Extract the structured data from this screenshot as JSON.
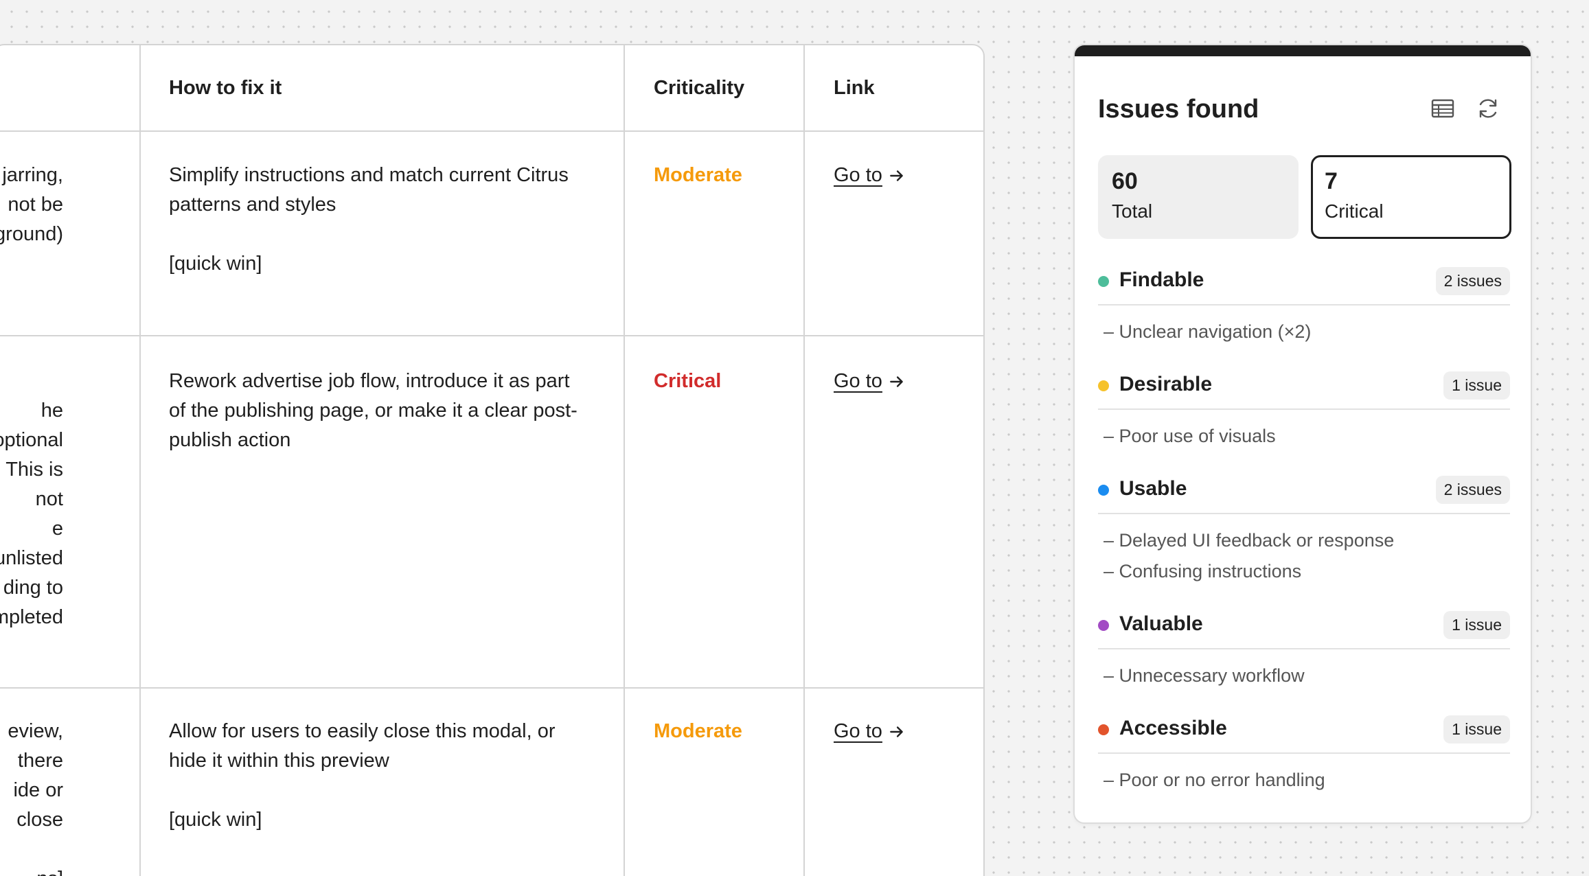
{
  "table": {
    "headers": {
      "how_to_fix": "How to fix it",
      "criticality": "Criticality",
      "link": "Link"
    },
    "rows": [
      {
        "issue": "jarring,\nnot be\nkground)",
        "fix": "Simplify instructions and match current Citrus\npatterns and styles\n\n[quick win]",
        "criticality": "Moderate",
        "link": "Go to"
      },
      {
        "issue": "he optional\ng. This is not\ne\n/unlisted\nding to\ncompleted",
        "fix": "Rework advertise job flow, introduce it as part\nof the publishing page, or make it a clear post-\npublish action",
        "criticality": "Critical",
        "link": "Go to"
      },
      {
        "issue": "eview, there\nide or close\n\nns]",
        "fix": "Allow for users to easily close this modal, or\nhide it within this preview\n\n[quick win]",
        "criticality": "Moderate",
        "link": "Go to"
      }
    ]
  },
  "colors": {
    "moderate": "#f59a0b",
    "critical": "#d12c2c",
    "findable": "#4dbd9a",
    "desirable": "#f6c22b",
    "usable": "#1a8cf0",
    "valuable": "#a24bc4",
    "accessible": "#e2542c"
  },
  "issues_card": {
    "title": "Issues found",
    "icons": [
      "table-view-icon",
      "refresh-icon"
    ],
    "stats": {
      "total_value": "60",
      "total_label": "Total",
      "critical_value": "7",
      "critical_label": "Critical"
    },
    "categories": [
      {
        "name": "Findable",
        "badge": "2 issues",
        "items": [
          "– Unclear navigation (×2)"
        ]
      },
      {
        "name": "Desirable",
        "badge": "1 issue",
        "items": [
          "– Poor use of visuals"
        ]
      },
      {
        "name": "Usable",
        "badge": "2 issues",
        "items": [
          "– Delayed UI feedback or response",
          "– Confusing instructions"
        ]
      },
      {
        "name": "Valuable",
        "badge": "1 issue",
        "items": [
          "– Unnecessary workflow"
        ]
      },
      {
        "name": "Accessible",
        "badge": "1 issue",
        "items": [
          "– Poor or no error handling"
        ]
      }
    ]
  }
}
